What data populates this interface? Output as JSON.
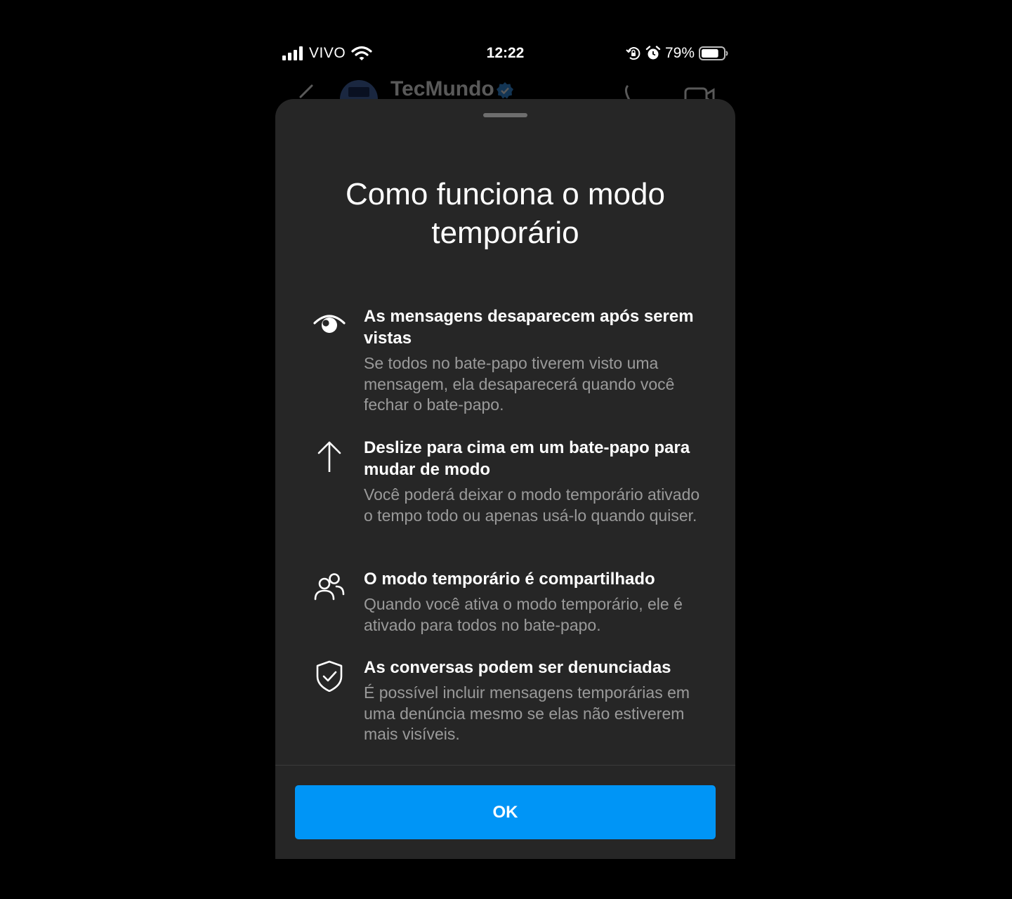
{
  "status_bar": {
    "carrier": "VIVO",
    "time": "12:22",
    "battery_percent": "79%",
    "battery_level": 0.79,
    "icons": [
      "signal-icon",
      "wifi-icon",
      "rotation-lock-icon",
      "alarm-icon",
      "battery-icon"
    ]
  },
  "chat_header": {
    "contact_name": "TecMundo",
    "verified": true,
    "icons": [
      "back-icon",
      "avatar",
      "verified-icon",
      "phone-icon",
      "video-call-icon"
    ]
  },
  "sheet": {
    "title": "Como funciona o modo temporário",
    "features": [
      {
        "icon": "eye-icon",
        "title": "As mensagens desaparecem após serem vistas",
        "description": "Se todos no bate-papo tiverem visto uma mensagem, ela desaparecerá quando você fechar o bate-papo."
      },
      {
        "icon": "arrow-up-icon",
        "title": "Deslize para cima em um bate-papo para mudar de modo",
        "description": "Você poderá deixar o modo temporário ativado o tempo todo ou apenas usá-lo quando quiser."
      },
      {
        "icon": "people-icon",
        "title": "O modo temporário é compartilhado",
        "description": "Quando você ativa o modo temporário, ele é ativado para todos no bate-papo."
      },
      {
        "icon": "shield-check-icon",
        "title": "As conversas podem ser denunciadas",
        "description": "É possível incluir mensagens temporárias em uma denúncia mesmo se elas não estiverem mais visíveis."
      }
    ],
    "ok_label": "OK"
  },
  "colors": {
    "background": "#000000",
    "sheet": "#262626",
    "primary_text": "#ffffff",
    "secondary_text": "#9a9a9a",
    "accent": "#0095f6"
  }
}
